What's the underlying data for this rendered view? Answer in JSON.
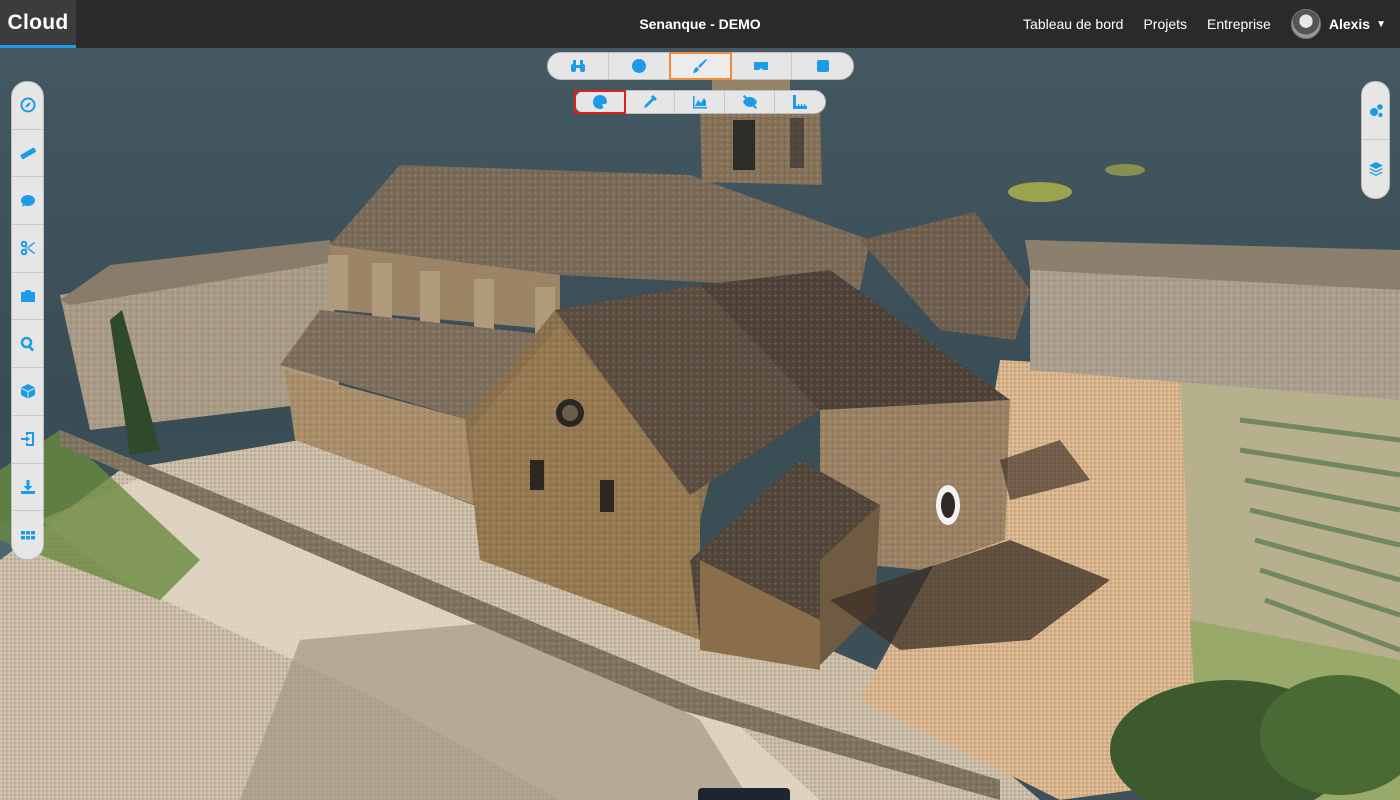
{
  "app": {
    "brand": "Cloud",
    "title": "Senanque - DEMO"
  },
  "nav": {
    "items": [
      "Tableau de bord",
      "Projets",
      "Entreprise"
    ],
    "user_name": "Alexis"
  },
  "toolbar_top": [
    {
      "icon": "binoculars-icon"
    },
    {
      "icon": "globe-icon"
    },
    {
      "icon": "brush-icon",
      "active": true
    },
    {
      "icon": "vr-headset-icon"
    },
    {
      "icon": "cube-icon"
    }
  ],
  "toolbar_sub": [
    {
      "icon": "palette-icon",
      "active": true
    },
    {
      "icon": "eyedropper-icon"
    },
    {
      "icon": "area-chart-icon"
    },
    {
      "icon": "eye-slash-icon"
    },
    {
      "icon": "ruler-corner-icon"
    }
  ],
  "toolbar_left": [
    "compass-icon",
    "ruler-icon",
    "comment-icon",
    "scissors-icon",
    "camera-icon",
    "search-icon",
    "box-icon",
    "import-icon",
    "download-icon",
    "grid-icon"
  ],
  "toolbar_right": [
    "settings-icon",
    "layers-icon"
  ],
  "colors": {
    "accent": "#1e9be8",
    "active_mode": "#f08a3c",
    "active_sub": "#e02020",
    "topbar": "#2a2a2a"
  }
}
